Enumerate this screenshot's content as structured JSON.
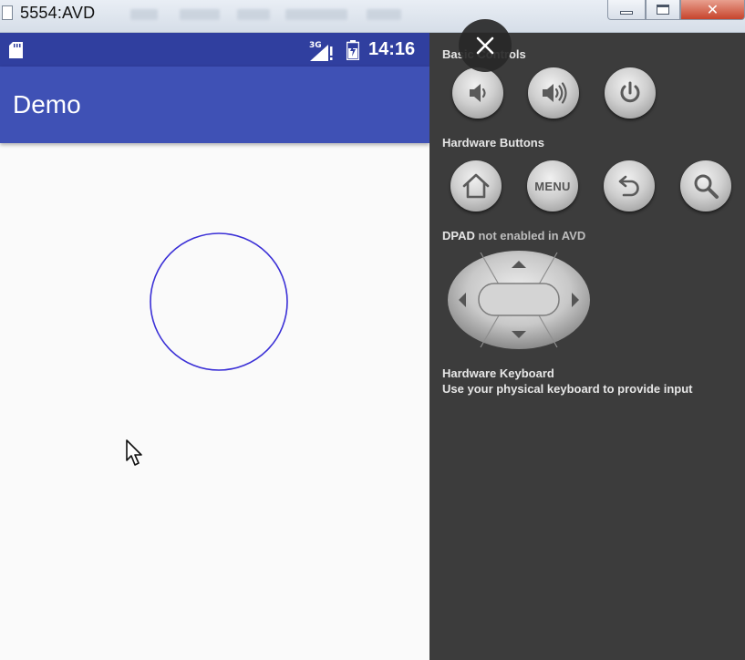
{
  "window": {
    "title": "5554:AVD",
    "menu_items": [
      "",
      "",
      "",
      "",
      ""
    ],
    "buttons": {
      "minimize": "",
      "maximize": "",
      "close": "✕"
    }
  },
  "phone": {
    "status_bar": {
      "network": "3G",
      "time": "14:16"
    },
    "app_bar": {
      "title": "Demo"
    }
  },
  "overlay": {
    "close_label": "✕"
  },
  "panel": {
    "basic_controls": {
      "title": "Basic Controls",
      "buttons": [
        "volume-down-icon",
        "volume-up-icon",
        "power-icon"
      ]
    },
    "hardware_buttons": {
      "title": "Hardware Buttons",
      "buttons": [
        "home-icon",
        "MENU",
        "back-icon",
        "search-icon"
      ]
    },
    "dpad": {
      "title_prefix": "DPAD",
      "title_suffix": " not enabled in AVD"
    },
    "hardware_keyboard": {
      "title": "Hardware Keyboard",
      "description": "Use your physical keyboard to provide input"
    }
  },
  "colors": {
    "status_bar": "#303f9f",
    "app_bar": "#3f51b5",
    "panel_bg": "#3c3c3c",
    "circle_stroke": "#3a2fd6"
  }
}
